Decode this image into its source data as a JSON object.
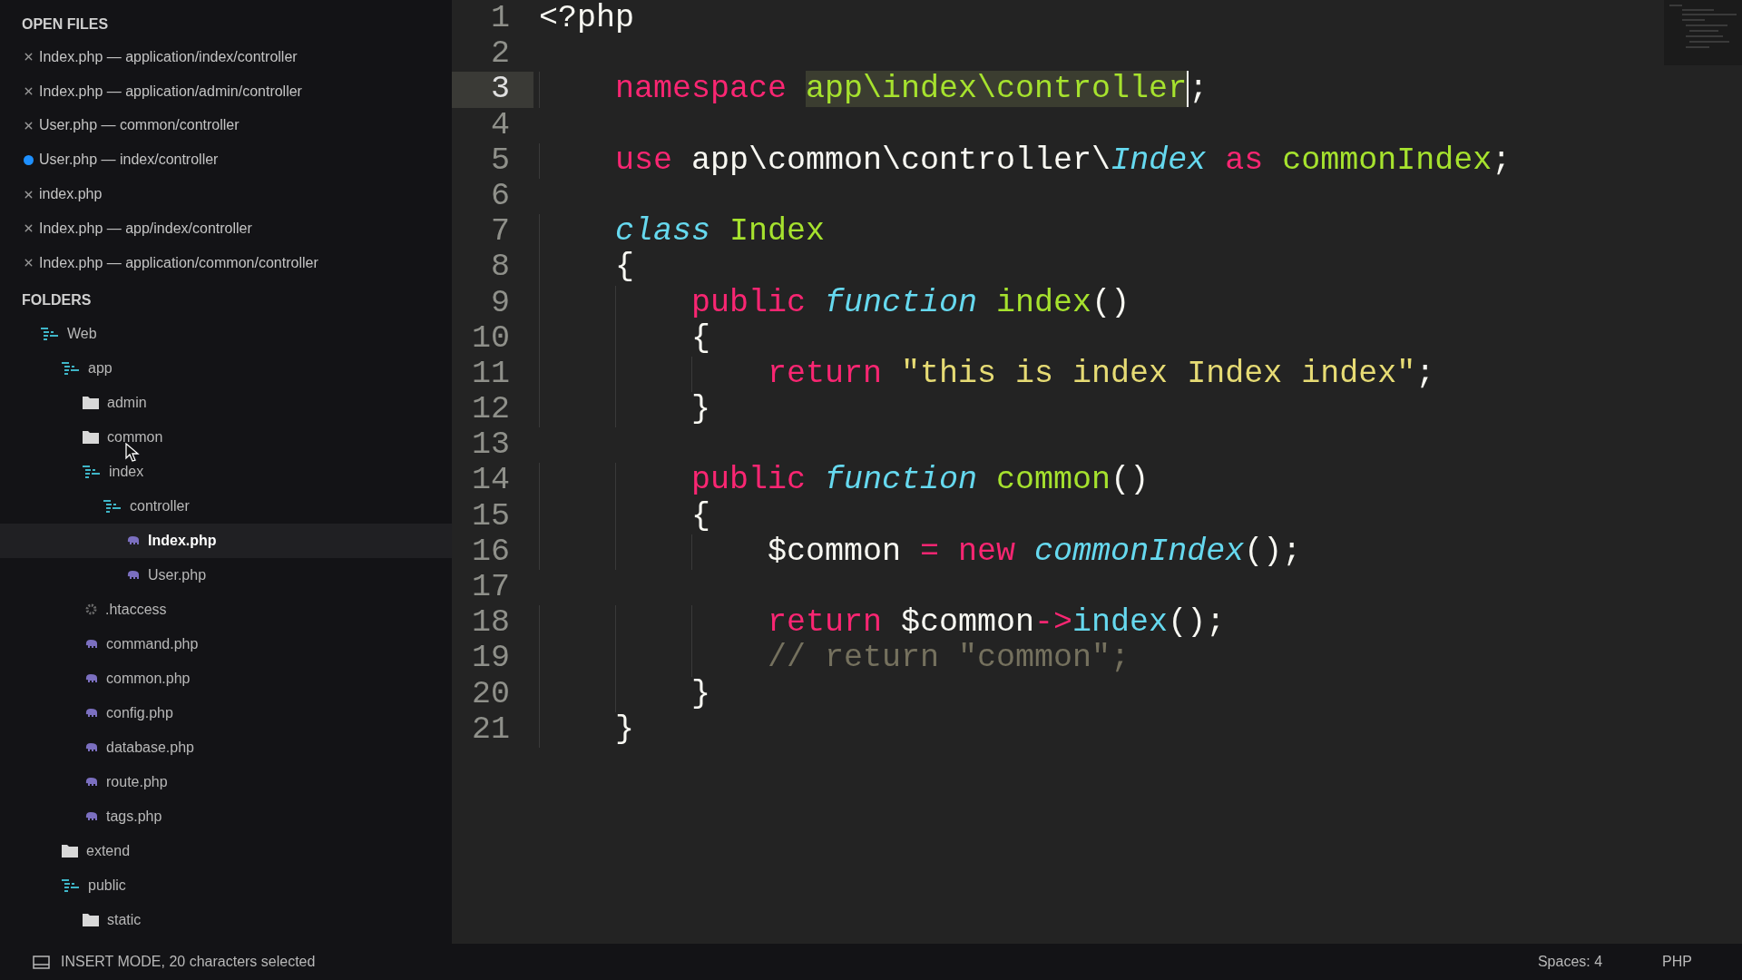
{
  "sidebar": {
    "open_files": {
      "title": "OPEN FILES",
      "items": [
        {
          "label": "Index.php — application/index/controller",
          "modified": false
        },
        {
          "label": "Index.php — application/admin/controller",
          "modified": false
        },
        {
          "label": "User.php — common/controller",
          "modified": false
        },
        {
          "label": "User.php — index/controller",
          "modified": true
        },
        {
          "label": "index.php",
          "modified": false
        },
        {
          "label": "Index.php — app/index/controller",
          "modified": false
        },
        {
          "label": "Index.php — application/common/controller",
          "modified": false
        }
      ]
    },
    "folders": {
      "title": "FOLDERS",
      "tree": [
        {
          "name": "Web",
          "kind": "open-folder",
          "selected": false,
          "children": [
            {
              "name": "app",
              "kind": "open-folder",
              "selected": false,
              "children": [
                {
                  "name": "admin",
                  "kind": "folder",
                  "selected": false
                },
                {
                  "name": "common",
                  "kind": "folder",
                  "selected": false
                },
                {
                  "name": "index",
                  "kind": "open-folder",
                  "selected": false,
                  "children": [
                    {
                      "name": "controller",
                      "kind": "open-folder",
                      "selected": false,
                      "children": [
                        {
                          "name": "Index.php",
                          "kind": "php",
                          "selected": true
                        },
                        {
                          "name": "User.php",
                          "kind": "php",
                          "selected": false
                        }
                      ]
                    }
                  ]
                },
                {
                  "name": ".htaccess",
                  "kind": "config",
                  "selected": false
                },
                {
                  "name": "command.php",
                  "kind": "php",
                  "selected": false
                },
                {
                  "name": "common.php",
                  "kind": "php",
                  "selected": false
                },
                {
                  "name": "config.php",
                  "kind": "php",
                  "selected": false
                },
                {
                  "name": "database.php",
                  "kind": "php",
                  "selected": false
                },
                {
                  "name": "route.php",
                  "kind": "php",
                  "selected": false
                },
                {
                  "name": "tags.php",
                  "kind": "php",
                  "selected": false
                }
              ]
            },
            {
              "name": "extend",
              "kind": "folder",
              "selected": false
            },
            {
              "name": "public",
              "kind": "open-folder",
              "selected": false,
              "children": [
                {
                  "name": "static",
                  "kind": "folder",
                  "selected": false
                }
              ]
            }
          ]
        }
      ]
    }
  },
  "editor": {
    "lines": [
      {
        "number": "1",
        "current": false,
        "tokens": [
          {
            "kind": "plain",
            "text": "<?php"
          }
        ]
      },
      {
        "number": "2",
        "current": false
      },
      {
        "number": "3",
        "current": true,
        "tokens": [
          {
            "kind": "keyword",
            "text": "    namespace "
          },
          {
            "kind": "selection",
            "text": "app\\index\\controller"
          },
          {
            "kind": "plain",
            "text": ";"
          }
        ]
      },
      {
        "number": "4",
        "current": false
      },
      {
        "number": "5",
        "current": false,
        "tokens": [
          {
            "kind": "keyword",
            "text": "    use"
          },
          {
            "kind": "plain",
            "text": " app\\common\\controller\\"
          },
          {
            "kind": "type",
            "text": "Index"
          },
          {
            "kind": "keyword",
            "text": " as "
          },
          {
            "kind": "entity",
            "text": "commonIndex"
          },
          {
            "kind": "plain",
            "text": ";"
          }
        ]
      },
      {
        "number": "6",
        "current": false
      },
      {
        "number": "7",
        "current": false,
        "tokens": [
          {
            "kind": "type",
            "text": "    class "
          },
          {
            "kind": "entity",
            "text": "Index"
          }
        ]
      },
      {
        "number": "8",
        "current": false,
        "tokens": [
          {
            "kind": "plain",
            "text": "    {"
          }
        ]
      },
      {
        "number": "9",
        "current": false,
        "tokens": [
          {
            "kind": "keyword",
            "text": "        public "
          },
          {
            "kind": "type",
            "text": "function "
          },
          {
            "kind": "entity",
            "text": "index"
          },
          {
            "kind": "plain",
            "text": "()"
          }
        ]
      },
      {
        "number": "10",
        "current": false,
        "tokens": [
          {
            "kind": "plain",
            "text": "        {"
          }
        ]
      },
      {
        "number": "11",
        "current": false,
        "tokens": [
          {
            "kind": "keyword",
            "text": "            return "
          },
          {
            "kind": "string",
            "text": "\"this is index Index index\""
          },
          {
            "kind": "plain",
            "text": ";"
          }
        ]
      },
      {
        "number": "12",
        "current": false,
        "tokens": [
          {
            "kind": "plain",
            "text": "        }"
          }
        ]
      },
      {
        "number": "13",
        "current": false
      },
      {
        "number": "14",
        "current": false,
        "tokens": [
          {
            "kind": "keyword",
            "text": "        public "
          },
          {
            "kind": "type",
            "text": "function "
          },
          {
            "kind": "entity",
            "text": "common"
          },
          {
            "kind": "plain",
            "text": "()"
          }
        ]
      },
      {
        "number": "15",
        "current": false,
        "tokens": [
          {
            "kind": "plain",
            "text": "        {"
          }
        ]
      },
      {
        "number": "16",
        "current": false,
        "tokens": [
          {
            "kind": "plain",
            "text": "            $common "
          },
          {
            "kind": "keyword",
            "text": "= new "
          },
          {
            "kind": "type",
            "text": "commonIndex"
          },
          {
            "kind": "plain",
            "text": "();"
          }
        ]
      },
      {
        "number": "17",
        "current": false
      },
      {
        "number": "18",
        "current": false,
        "tokens": [
          {
            "kind": "keyword",
            "text": "            return"
          },
          {
            "kind": "plain",
            "text": " $common"
          },
          {
            "kind": "keyword",
            "text": "->"
          },
          {
            "kind": "support",
            "text": "index"
          },
          {
            "kind": "plain",
            "text": "();"
          }
        ]
      },
      {
        "number": "19",
        "current": false,
        "tokens": [
          {
            "kind": "comment",
            "text": "            // return \"common\";"
          }
        ]
      },
      {
        "number": "20",
        "current": false,
        "tokens": [
          {
            "kind": "plain",
            "text": "        }"
          }
        ]
      },
      {
        "number": "21",
        "current": false,
        "tokens": [
          {
            "kind": "plain",
            "text": "    }"
          }
        ]
      }
    ]
  },
  "status_bar": {
    "message": "INSERT MODE, 20 characters selected",
    "indentation": "Spaces: 4",
    "syntax": "PHP"
  }
}
